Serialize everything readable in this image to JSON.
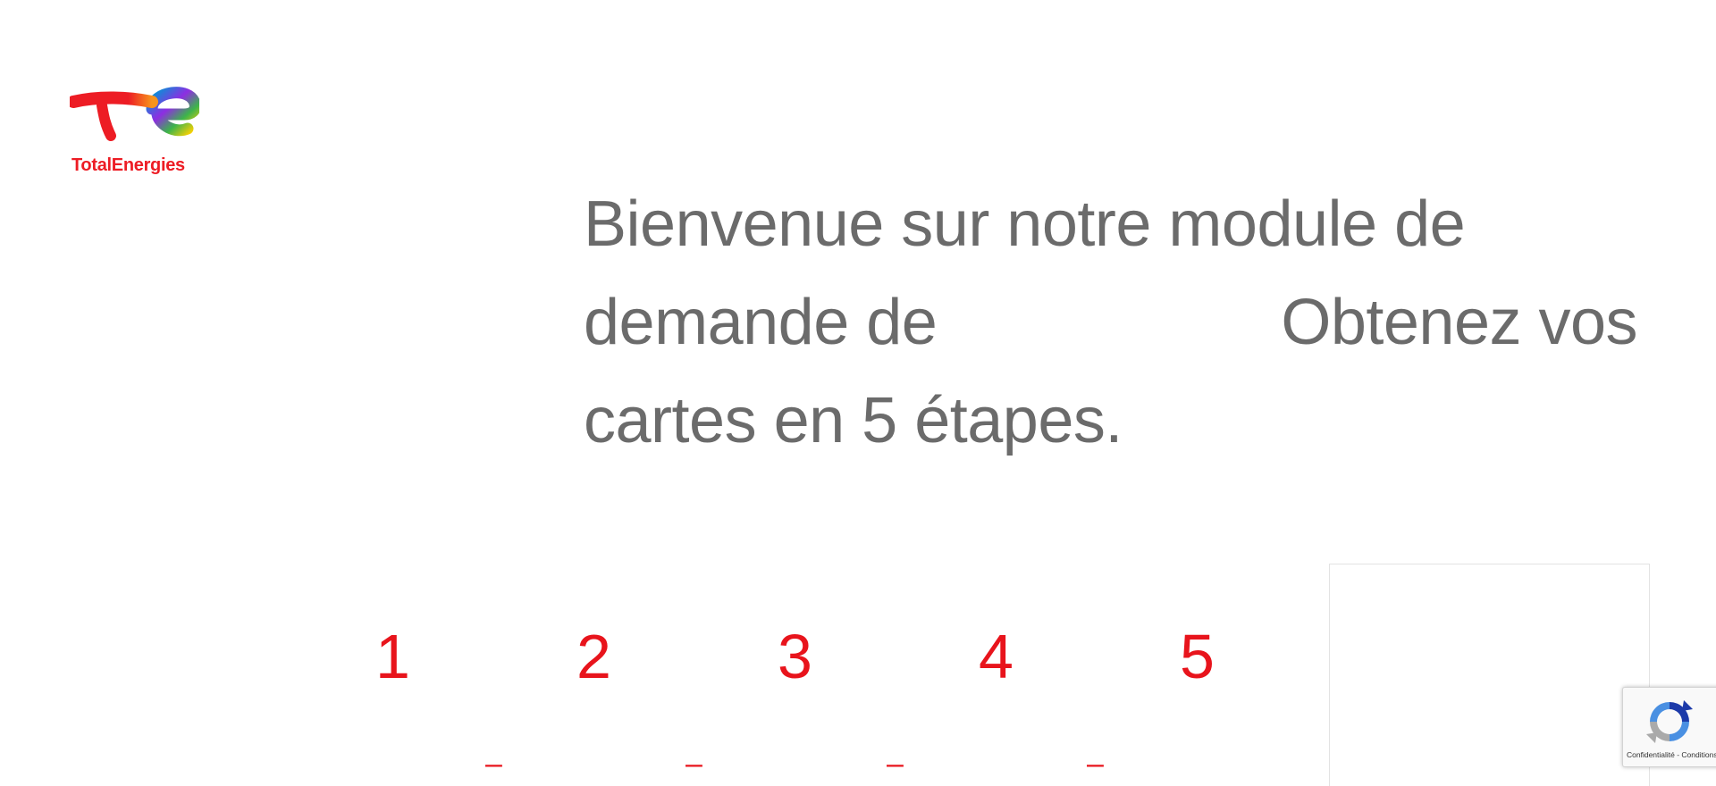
{
  "brand": {
    "name": "TotalEnergies",
    "logo_icon": "totalenergies-logo-icon",
    "colors": {
      "red": "#ed1c24",
      "orange": "#f7941d",
      "yellow": "#ffd200",
      "green": "#3cb44b",
      "blue": "#0096d6",
      "purple": "#8e2de2"
    }
  },
  "welcome": {
    "line1": "Bienvenue sur notre module de",
    "line2_start": "demande de",
    "line2_end": "Obtenez vos",
    "line3": "cartes en 5 étapes."
  },
  "steps": {
    "items": [
      {
        "number": "1"
      },
      {
        "number": "2"
      },
      {
        "number": "3"
      },
      {
        "number": "4"
      },
      {
        "number": "5"
      }
    ],
    "separator": "–",
    "accent_color": "#e8141c"
  },
  "recaptcha": {
    "icon": "recaptcha-icon",
    "links": "Confidentialité - Conditions"
  },
  "theme": {
    "text_gray": "#6b6b6b",
    "background": "#ffffff"
  }
}
